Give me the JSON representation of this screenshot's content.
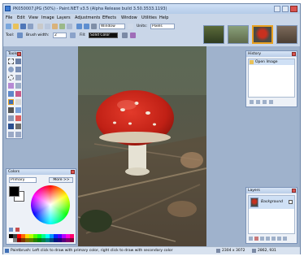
{
  "window": {
    "title": "PK050007.JPG (50%) - Paint.NET v3.5 (Alpha Release build 3.50.3533.1193)"
  },
  "menu": [
    "File",
    "Edit",
    "View",
    "Image",
    "Layers",
    "Adjustments",
    "Effects",
    "Window",
    "Utilities",
    "Help"
  ],
  "toolbar": {
    "window_label": "Window",
    "units_label": "Units:",
    "units_value": "Pixels"
  },
  "toolbar2": {
    "tool_label": "Tool:",
    "brush_width_label": "Brush width:",
    "brush_width_value": "2",
    "fill_label": "Fill:",
    "fill_value": "Solid Color"
  },
  "panels": {
    "tools": {
      "title": "Tools"
    },
    "history": {
      "title": "History",
      "items": [
        "Open Image"
      ]
    },
    "colors": {
      "title": "Colors",
      "primary_label": "Primary",
      "more_label": "More >>"
    },
    "layers": {
      "title": "Layers",
      "items": [
        "Background"
      ]
    }
  },
  "status": {
    "hint": "Paintbrush: Left click to draw with primary color, right click to draw with secondary color",
    "image_size": "2304 x 3072",
    "cursor_pos": "2862, 931"
  },
  "colors_accent": {
    "primary_color": "#000000",
    "secondary_color": "#ffffff"
  }
}
